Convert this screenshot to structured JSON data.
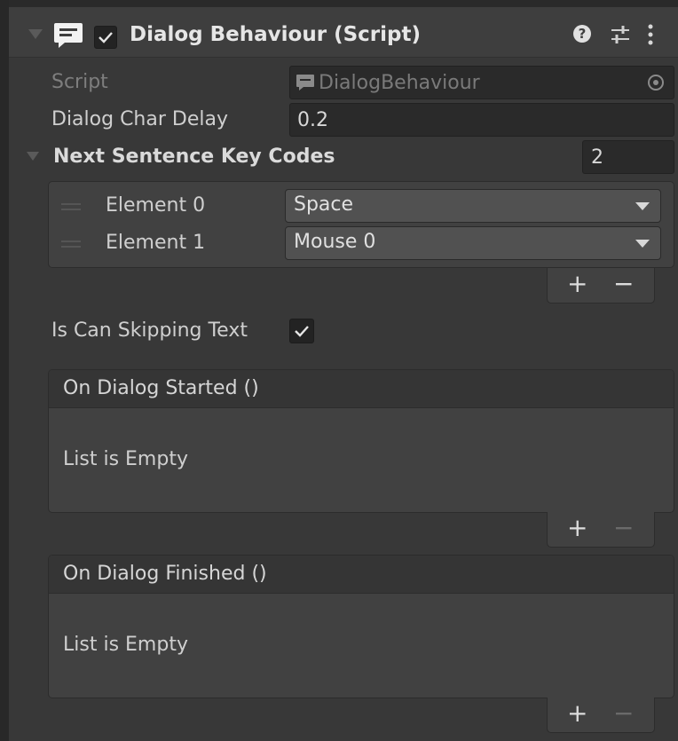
{
  "header": {
    "title": "Dialog Behaviour (Script)",
    "enabled": true
  },
  "fields": {
    "script": {
      "label": "Script",
      "value": "DialogBehaviour"
    },
    "char_delay": {
      "label": "Dialog Char Delay",
      "value": "0.2"
    }
  },
  "key_codes": {
    "label": "Next Sentence Key Codes",
    "size": "2",
    "elements": [
      {
        "label": "Element 0",
        "value": "Space"
      },
      {
        "label": "Element 1",
        "value": "Mouse 0"
      }
    ],
    "add": "+",
    "remove": "−"
  },
  "skipping": {
    "label": "Is Can Skipping Text",
    "checked": true
  },
  "events": [
    {
      "title": "On Dialog Started ()",
      "empty_text": "List is Empty",
      "add": "+",
      "remove": "−"
    },
    {
      "title": "On Dialog Finished ()",
      "empty_text": "List is Empty",
      "add": "+",
      "remove": "−"
    }
  ],
  "icons": {
    "foldout": "triangle-down-icon",
    "component": "dialog-bubble-icon",
    "help": "question-icon",
    "preset": "sliders-icon",
    "menu": "kebab-menu-icon",
    "picker": "target-circle-icon",
    "dropdown": "caret-down-icon"
  },
  "colors": {
    "background": "#383838",
    "header": "#3e3e3e",
    "field": "#2a2a2a",
    "dropdown": "#515151",
    "text": "#d2d2d2"
  }
}
